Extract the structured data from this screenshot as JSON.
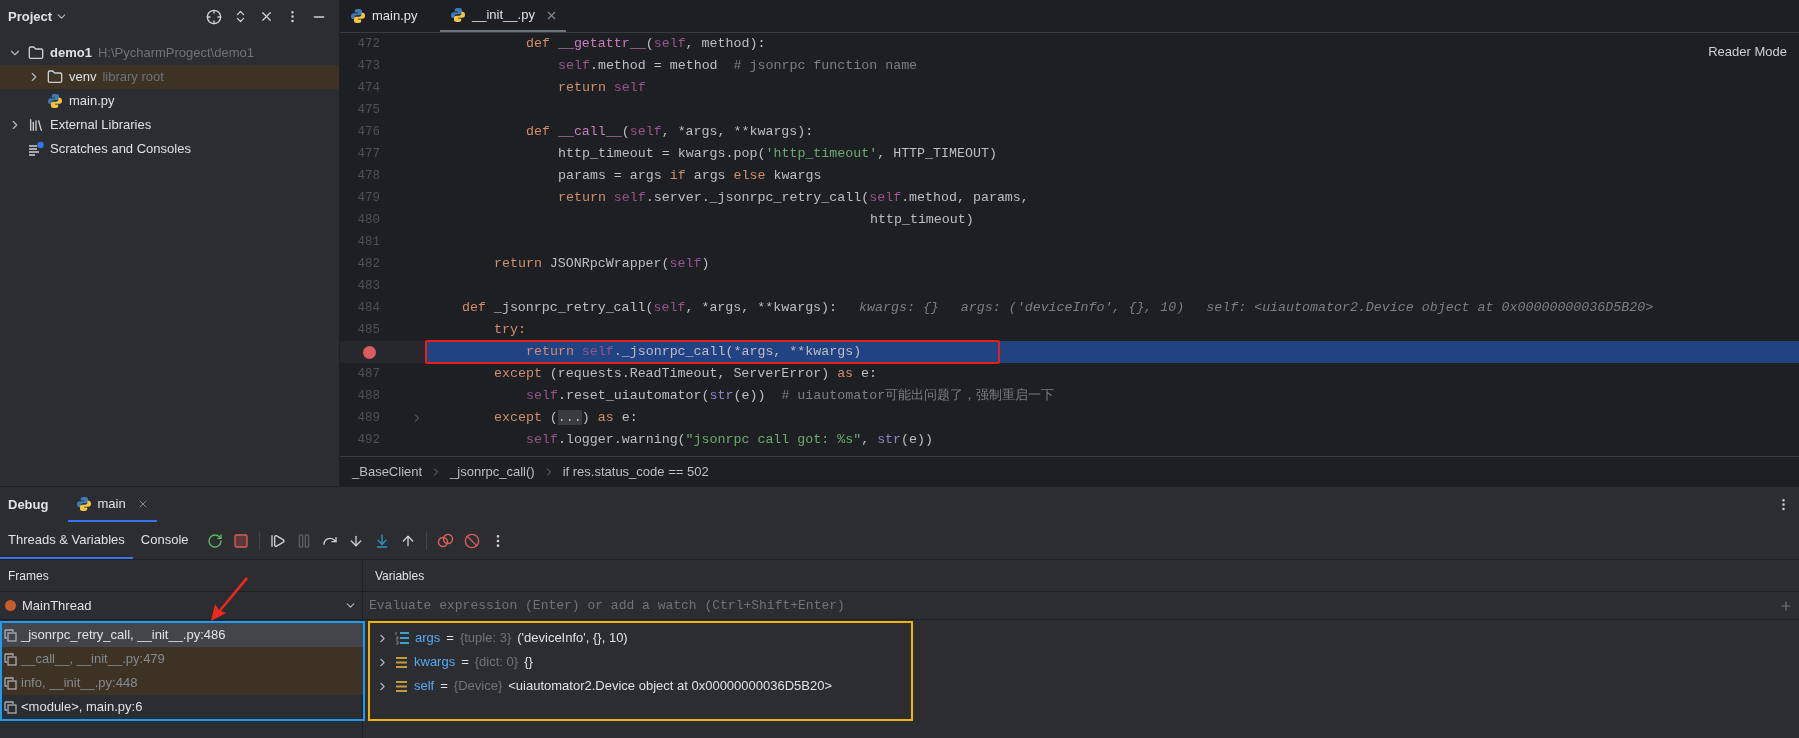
{
  "project_panel": {
    "title": "Project",
    "tree": [
      {
        "name": "demo1",
        "note": "H:\\PycharmProgect\\demo1",
        "kind": "folder",
        "expanded": true,
        "library": false,
        "children": [
          {
            "name": "venv",
            "note": "library root",
            "kind": "folder",
            "expanded": false,
            "library": true
          },
          {
            "name": "main.py",
            "kind": "python",
            "library": false
          }
        ]
      },
      {
        "name": "External Libraries",
        "kind": "libraries",
        "expanded": false,
        "library": false
      },
      {
        "name": "Scratches and Consoles",
        "kind": "scratches",
        "library": false
      }
    ]
  },
  "editor": {
    "tabs": [
      {
        "label": "main.py",
        "selected": false
      },
      {
        "label": "__init__.py",
        "selected": true
      }
    ],
    "reader_mode": "Reader Mode",
    "lines": [
      {
        "number": "472",
        "breakpoint": false,
        "current": false,
        "folded": false,
        "tokens": [
          {
            "kind": "kw",
            "text": "        def "
          },
          {
            "kind": "magic",
            "text": "__getattr__"
          },
          {
            "kind": "plain",
            "text": "("
          },
          {
            "kind": "self",
            "text": "self"
          },
          {
            "kind": "plain",
            "text": ", method):"
          }
        ]
      },
      {
        "number": "473",
        "breakpoint": false,
        "current": false,
        "folded": false,
        "tokens": [
          {
            "kind": "self",
            "text": "            self"
          },
          {
            "kind": "plain",
            "text": ".method = method  "
          },
          {
            "kind": "comment",
            "text": "# jsonrpc function name"
          }
        ]
      },
      {
        "number": "474",
        "breakpoint": false,
        "current": false,
        "folded": false,
        "tokens": [
          {
            "kind": "kw",
            "text": "            return "
          },
          {
            "kind": "self",
            "text": "self"
          }
        ]
      },
      {
        "number": "475",
        "breakpoint": false,
        "current": false,
        "folded": false
      },
      {
        "number": "476",
        "breakpoint": false,
        "current": false,
        "folded": false,
        "tokens": [
          {
            "kind": "kw",
            "text": "        def "
          },
          {
            "kind": "magic",
            "text": "__call__"
          },
          {
            "kind": "plain",
            "text": "("
          },
          {
            "kind": "self",
            "text": "self"
          },
          {
            "kind": "plain",
            "text": ", *args, **kwargs):"
          }
        ]
      },
      {
        "number": "477",
        "breakpoint": false,
        "current": false,
        "folded": false,
        "tokens": [
          {
            "kind": "plain",
            "text": "            http_timeout = kwargs.pop("
          },
          {
            "kind": "str",
            "text": "'http_timeout'"
          },
          {
            "kind": "plain",
            "text": ", HTTP_TIMEOUT)"
          }
        ]
      },
      {
        "number": "478",
        "breakpoint": false,
        "current": false,
        "folded": false,
        "tokens": [
          {
            "kind": "plain",
            "text": "            params = args "
          },
          {
            "kind": "kw",
            "text": "if "
          },
          {
            "kind": "plain",
            "text": "args "
          },
          {
            "kind": "kw",
            "text": "else "
          },
          {
            "kind": "plain",
            "text": "kwargs"
          }
        ]
      },
      {
        "number": "479",
        "breakpoint": false,
        "current": false,
        "folded": false,
        "tokens": [
          {
            "kind": "kw",
            "text": "            return "
          },
          {
            "kind": "self",
            "text": "self"
          },
          {
            "kind": "plain",
            "text": ".server._jsonrpc_retry_call("
          },
          {
            "kind": "self",
            "text": "self"
          },
          {
            "kind": "plain",
            "text": ".method, params,"
          }
        ]
      },
      {
        "number": "480",
        "breakpoint": false,
        "current": false,
        "folded": false,
        "tokens": [
          {
            "kind": "plain",
            "text": "                                                   http_timeout)"
          }
        ]
      },
      {
        "number": "481",
        "breakpoint": false,
        "current": false,
        "folded": false
      },
      {
        "number": "482",
        "breakpoint": false,
        "current": false,
        "folded": false,
        "tokens": [
          {
            "kind": "kw",
            "text": "    return "
          },
          {
            "kind": "plain",
            "text": "JSONRpcWrapper("
          },
          {
            "kind": "self",
            "text": "self"
          },
          {
            "kind": "plain",
            "text": ")"
          }
        ]
      },
      {
        "number": "483",
        "breakpoint": false,
        "current": false,
        "folded": false
      },
      {
        "number": "484",
        "breakpoint": false,
        "current": false,
        "folded": false,
        "tokens": [
          {
            "kind": "kw",
            "text": "def "
          },
          {
            "kind": "plain",
            "text": "_jsonrpc_retry_call("
          },
          {
            "kind": "self",
            "text": "self"
          },
          {
            "kind": "plain",
            "text": ", *args, **kwargs):"
          }
        ],
        "hints": [
          "kwargs: {}",
          "args: ('deviceInfo', {}, 10)",
          "self: <uiautomator2.Device object at 0x00000000036D5B20>"
        ]
      },
      {
        "number": "485",
        "breakpoint": false,
        "current": false,
        "folded": false,
        "tokens": [
          {
            "kind": "kw",
            "text": "    try:"
          }
        ]
      },
      {
        "breakpoint": true,
        "current": true,
        "folded": false,
        "tokens": [
          {
            "kind": "kw",
            "text": "        return "
          },
          {
            "kind": "self",
            "text": "self"
          },
          {
            "kind": "plain",
            "text": "._jsonrpc_call(*args, **kwargs)"
          }
        ]
      },
      {
        "number": "487",
        "breakpoint": false,
        "current": false,
        "folded": false,
        "tokens": [
          {
            "kind": "kw",
            "text": "    except "
          },
          {
            "kind": "plain",
            "text": "(requests.ReadTimeout, ServerError) "
          },
          {
            "kind": "kw",
            "text": "as "
          },
          {
            "kind": "plain",
            "text": "e:"
          }
        ]
      },
      {
        "number": "488",
        "breakpoint": false,
        "current": false,
        "folded": false,
        "tokens": [
          {
            "kind": "self",
            "text": "        self"
          },
          {
            "kind": "plain",
            "text": ".reset_uiautomator("
          },
          {
            "kind": "builtin",
            "text": "str"
          },
          {
            "kind": "plain",
            "text": "(e))  "
          },
          {
            "kind": "comment",
            "text": "# uiautomator可能出问题了，强制重启一下"
          }
        ]
      },
      {
        "number": "489",
        "breakpoint": false,
        "current": false,
        "folded": true,
        "tokens": [
          {
            "kind": "kw",
            "text": "    except "
          },
          {
            "kind": "plain",
            "text": "("
          },
          {
            "kind": "fold",
            "text": "..."
          },
          {
            "kind": "plain",
            "text": ") "
          },
          {
            "kind": "kw",
            "text": "as "
          },
          {
            "kind": "plain",
            "text": "e:"
          }
        ]
      },
      {
        "number": "492",
        "breakpoint": false,
        "current": false,
        "folded": false,
        "tokens": [
          {
            "kind": "self",
            "text": "        self"
          },
          {
            "kind": "plain",
            "text": ".logger.warning("
          },
          {
            "kind": "str",
            "text": "\"jsonrpc call got: %s\""
          },
          {
            "kind": "plain",
            "text": ", "
          },
          {
            "kind": "builtin",
            "text": "str"
          },
          {
            "kind": "plain",
            "text": "(e))"
          }
        ]
      }
    ],
    "breadcrumbs": [
      "_BaseClient",
      "_jsonrpc_call()",
      "if res.status_code == 502"
    ]
  },
  "debug": {
    "title": "Debug",
    "session": "main",
    "tabs": [
      {
        "label": "Threads & Variables",
        "selected": true
      },
      {
        "label": "Console",
        "selected": false
      }
    ],
    "toolbar": [
      {
        "kind": "rerun",
        "disabled": false
      },
      {
        "kind": "stop",
        "disabled": false
      },
      {
        "kind": "resume",
        "disabled": false
      },
      {
        "kind": "pause",
        "disabled": true
      },
      {
        "kind": "step_over",
        "disabled": false
      },
      {
        "kind": "step_into",
        "disabled": false
      },
      {
        "kind": "step_into_my_code",
        "disabled": false
      },
      {
        "kind": "step_out",
        "disabled": false
      },
      {
        "kind": "breakpoints",
        "disabled": false
      },
      {
        "kind": "mute",
        "disabled": false
      },
      {
        "kind": "more",
        "disabled": false
      }
    ],
    "frames_title": "Frames",
    "thread": "MainThread",
    "frames": [
      {
        "label": "_jsonrpc_retry_call, __init__.py:486",
        "selected": true,
        "library": false
      },
      {
        "label": "__call__, __init__.py:479",
        "selected": false,
        "library": true
      },
      {
        "label": "info, __init__.py:448",
        "selected": false,
        "library": true
      },
      {
        "label": "<module>, main.py:6",
        "selected": false,
        "library": false
      }
    ],
    "variables_title": "Variables",
    "evaluate": {
      "placeholder": "Evaluate expression (Enter) or add a watch (Ctrl+Shift+Enter)"
    },
    "variables": [
      {
        "name": "args",
        "type": "{tuple: 3}",
        "value": "('deviceInfo', {}, 10)",
        "operator": "=",
        "kind": "tuple",
        "expanded": false
      },
      {
        "name": "kwargs",
        "type": "{dict: 0}",
        "value": "{}",
        "operator": "=",
        "kind": "object",
        "expanded": false
      },
      {
        "name": "self",
        "type": "{Device}",
        "value": "<uiautomator2.Device object at 0x00000000036D5B20>",
        "operator": "=",
        "kind": "object",
        "expanded": false
      }
    ]
  }
}
